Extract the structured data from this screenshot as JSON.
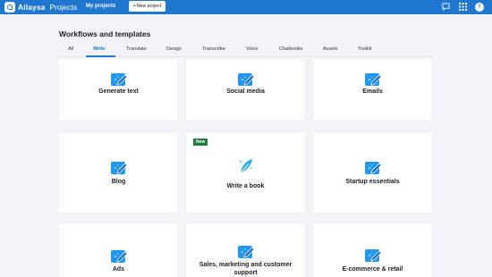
{
  "topbar": {
    "brand_name": "Ailaysa",
    "brand_sub": "Projects",
    "my_projects": "My projects",
    "new_project": "New project",
    "avatar_initial": "T"
  },
  "page": {
    "title": "Workflows and templates"
  },
  "tabs": [
    "All",
    "Write",
    "Translate",
    "Design",
    "Transcribe",
    "Voice",
    "Chatbooks",
    "Assets",
    "Toolkit"
  ],
  "cards": [
    {
      "label": "Generate text",
      "icon": "edit-sparkle-icon"
    },
    {
      "label": "Social media",
      "icon": "edit-sparkle-icon"
    },
    {
      "label": "Emails",
      "icon": "edit-sparkle-icon"
    },
    {
      "label": "Blog",
      "icon": "edit-sparkle-icon"
    },
    {
      "label": "Write a book",
      "icon": "feather-sparkle-icon",
      "badge": "New"
    },
    {
      "label": "Startup essentials",
      "icon": "edit-sparkle-icon"
    },
    {
      "label": "Ads",
      "icon": "edit-sparkle-icon"
    },
    {
      "label": "Sales, marketing and customer support",
      "icon": "edit-sparkle-icon"
    },
    {
      "label": "E-commerce & retail",
      "icon": "edit-sparkle-icon"
    }
  ],
  "colors": {
    "accent": "#1f77d0",
    "icon_blue": "#2196f3",
    "badge_green": "#1f7a3a"
  }
}
